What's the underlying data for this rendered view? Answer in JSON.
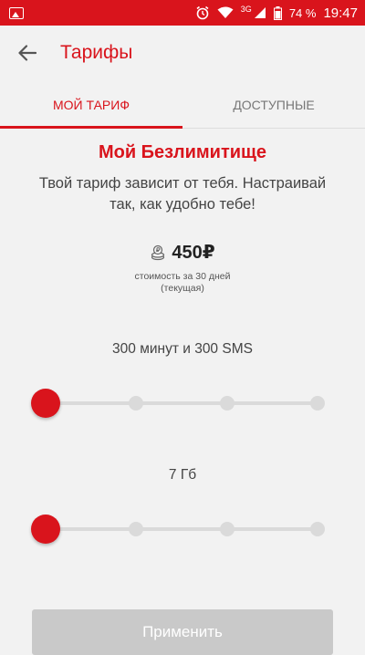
{
  "status_bar": {
    "network": "3G",
    "battery": "74 %",
    "time": "19:47"
  },
  "header": {
    "title": "Тарифы"
  },
  "tabs": [
    {
      "label": "МОЙ ТАРИФ",
      "active": true
    },
    {
      "label": "ДОСТУПНЫЕ",
      "active": false
    }
  ],
  "plan": {
    "name": "Мой Безлимитище",
    "description": "Твой тариф зависит от тебя. Настраивай так, как удобно тебе!",
    "price": "450₽",
    "price_note_line1": "стоимость за 30 дней",
    "price_note_line2": "(текущая)"
  },
  "sliders": {
    "minutes": {
      "label": "300 минут и 300 SMS",
      "steps": 4,
      "selected_index": 0
    },
    "data": {
      "label": "7 Гб",
      "steps": 4,
      "selected_index": 0
    }
  },
  "apply_button": {
    "label": "Применить",
    "enabled": false
  },
  "colors": {
    "accent": "#d9141c",
    "disabled": "#c9c9c9",
    "track": "#dadada"
  }
}
